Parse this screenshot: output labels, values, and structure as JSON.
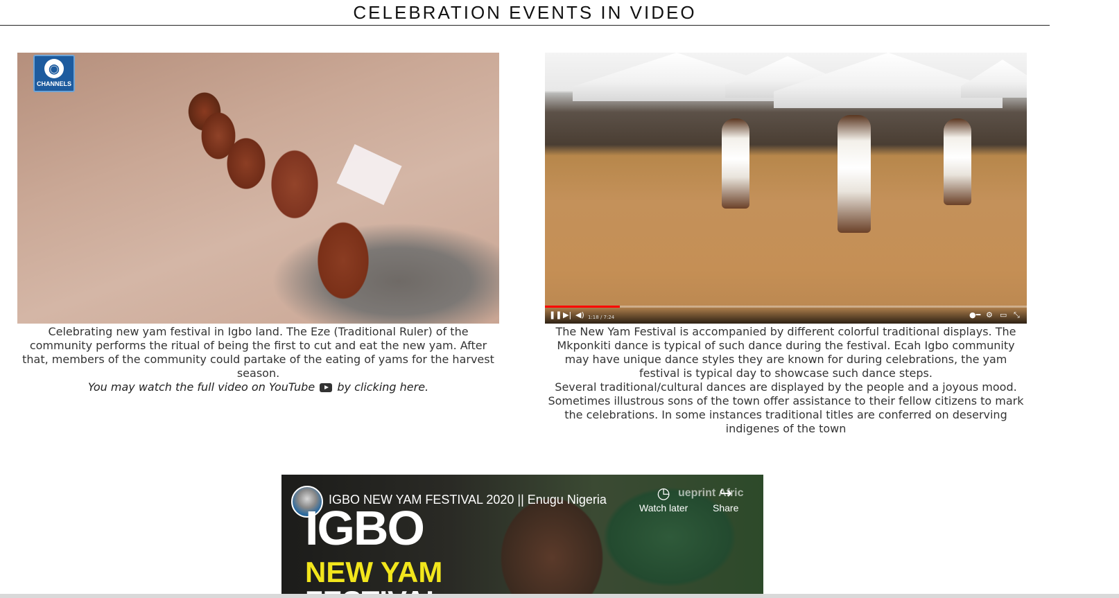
{
  "page": {
    "title": "CELEBRATION EVENTS IN VIDEO"
  },
  "left_video": {
    "channel_logo_text": "CHANNELS",
    "caption": "Celebrating new yam festival in Igbo land. The Eze (Traditional Ruler) of the community performs the ritual of being the first to cut and eat the new yam. After that, members of the community could partake of the eating of yams for the harvest season.",
    "watch_prefix": "You may watch the full video on YouTube",
    "watch_suffix": "by clicking here."
  },
  "right_video": {
    "time_readout": "1:18 / 7:24",
    "progress": 0.155,
    "caption_1": "The New Yam Festival is accompanied by different colorful traditional displays. The Mkponkiti dance is typical of such dance during the festival. Ecah Igbo community may have unique dance styles they are known for during celebrations, the yam festival is typical day to showcase such dance steps.",
    "caption_2": "Several traditional/cultural dances are displayed by the people and a joyous mood. Sometimes illustrous sons of the town offer assistance to their fellow citizens to mark the celebrations. In some instances traditional titles are conferred on deserving indigenes of the town"
  },
  "embed_video": {
    "title": "IGBO NEW YAM FESTIVAL 2020 || Enugu Nigeria",
    "watch_later_label": "Watch later",
    "share_label": "Share",
    "brand_overlay": "ueprint Afric",
    "poster_line_1": "IGBO",
    "poster_line_2": "NEW YAM",
    "poster_line_3": "FESTIVAL"
  },
  "colors": {
    "progress_red": "#ff0000",
    "poster_yellow": "#f2e61c"
  },
  "icons": [
    "pause-icon",
    "next-icon",
    "volume-icon",
    "settings-icon",
    "fullscreen-icon",
    "clock-icon",
    "share-icon",
    "youtube-icon"
  ]
}
